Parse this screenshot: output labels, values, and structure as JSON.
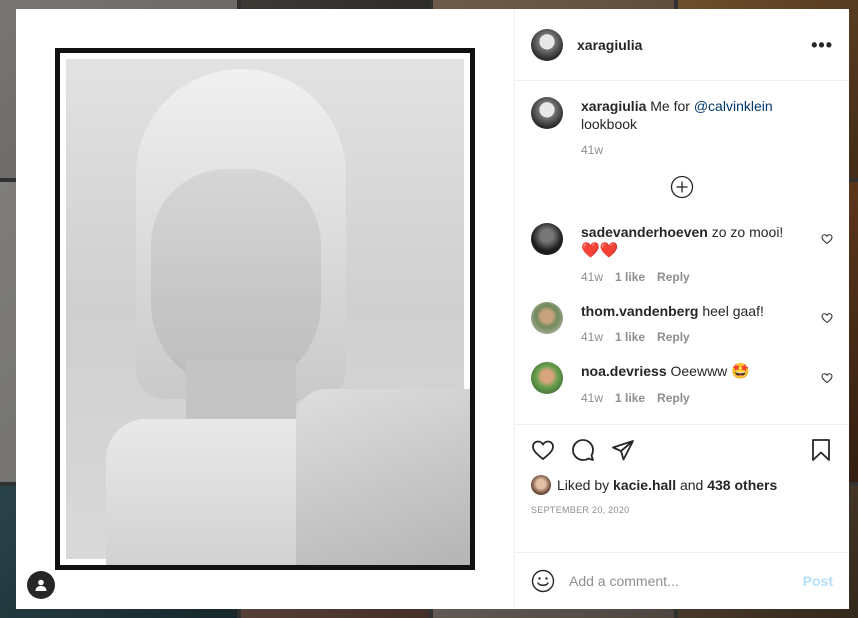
{
  "post": {
    "username": "xaragiulia",
    "caption": {
      "username": "xaragiulia",
      "text_before": "Me for ",
      "mention": "@calvinklein",
      "text_after": " lookbook",
      "time": "41w"
    },
    "comments": [
      {
        "username": "sadevanderhoeven",
        "text": "zo zo mooi!",
        "emoji": "❤️❤️",
        "time": "41w",
        "likes": "1 like",
        "reply": "Reply"
      },
      {
        "username": "thom.vandenberg",
        "text": "heel gaaf!",
        "emoji": "",
        "time": "41w",
        "likes": "1 like",
        "reply": "Reply"
      },
      {
        "username": "noa.devriess",
        "text": "Oeewww",
        "emoji": "🤩",
        "time": "41w",
        "likes": "1 like",
        "reply": "Reply"
      }
    ],
    "liked_by": {
      "prefix": "Liked by ",
      "user": "kacie.hall",
      "middle": " and ",
      "others": "438 others"
    },
    "date": "SEPTEMBER 20, 2020",
    "add_comment_placeholder": "Add a comment...",
    "post_label": "Post",
    "more_label": "•••"
  },
  "icons": {
    "heart": "heart-icon",
    "comment": "comment-icon",
    "share": "paper-plane-icon",
    "bookmark": "bookmark-icon",
    "emoji": "smiley-icon",
    "load_more": "plus-circle-icon",
    "user_tag": "user-tag-icon"
  },
  "colors": {
    "mention": "#00376b",
    "post_disabled": "#b2dffc",
    "muted": "#8e8e8e"
  }
}
